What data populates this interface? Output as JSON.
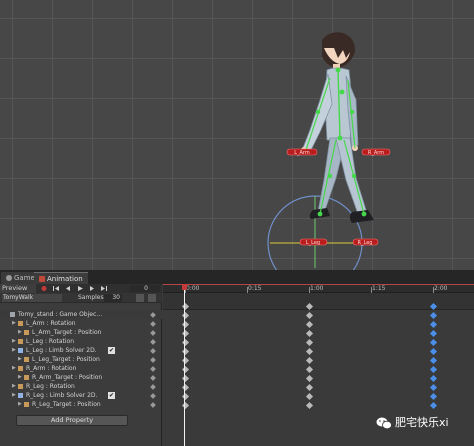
{
  "tabs": [
    {
      "label": "Game"
    },
    {
      "label": "Animation"
    }
  ],
  "controls": {
    "preview_label": "Preview",
    "frame": "0",
    "clip_name": "TomyWalk",
    "samples_label": "Samples",
    "samples_value": "30"
  },
  "timeline": {
    "ticks": [
      "0:00",
      "0:15",
      "1:00",
      "1:15",
      "2:00",
      "2:15"
    ]
  },
  "properties": [
    {
      "label": "Tomy_stand : Game Objec…",
      "indent": 0,
      "icon": "gameobject-icon"
    },
    {
      "label": "L_Arm : Rotation",
      "indent": 1,
      "icon": "transform-icon"
    },
    {
      "label": "L_Arm_Target : Position",
      "indent": 2,
      "icon": "transform-icon"
    },
    {
      "label": "L_Leg : Rotation",
      "indent": 1,
      "icon": "transform-icon"
    },
    {
      "label": "L_Leg : Limb Solver 2D.",
      "indent": 1,
      "icon": "solver-icon",
      "check": "✔"
    },
    {
      "label": "L_Leg_Target : Position",
      "indent": 2,
      "icon": "transform-icon"
    },
    {
      "label": "R_Arm : Rotation",
      "indent": 1,
      "icon": "transform-icon"
    },
    {
      "label": "R_Arm_Target : Position",
      "indent": 2,
      "icon": "transform-icon"
    },
    {
      "label": "R_Leg : Rotation",
      "indent": 1,
      "icon": "transform-icon"
    },
    {
      "label": "R_Leg : Limb Solver 2D.",
      "indent": 1,
      "icon": "solver-icon",
      "check": "✔"
    },
    {
      "label": "R_Leg_Target : Position",
      "indent": 2,
      "icon": "transform-icon"
    }
  ],
  "add_property_label": "Add Property",
  "scene_labels": {
    "l_arm": "L_Arm",
    "r_arm": "R_Arm",
    "l_leg": "L_Leg",
    "r_leg": "R_Leg"
  },
  "keyframes": {
    "columns": [
      {
        "time": "0:00",
        "color": "grey",
        "rows": [
          0,
          1,
          2,
          3,
          4,
          5,
          6,
          7,
          8,
          9,
          10,
          11
        ]
      },
      {
        "time": "1:00",
        "color": "grey",
        "rows": [
          0,
          1,
          2,
          3,
          4,
          5,
          6,
          7,
          8,
          9,
          10,
          11
        ]
      },
      {
        "time": "2:00",
        "color": "blue",
        "rows": [
          0,
          1,
          2,
          3,
          4,
          5,
          6,
          7,
          8,
          9,
          10,
          11
        ]
      }
    ]
  },
  "colors": {
    "accent_red": "#c43a3a",
    "key_blue": "#4a8fe8",
    "bone_green": "#44d84a"
  },
  "watermark": {
    "text": "肥宅快乐xi"
  }
}
